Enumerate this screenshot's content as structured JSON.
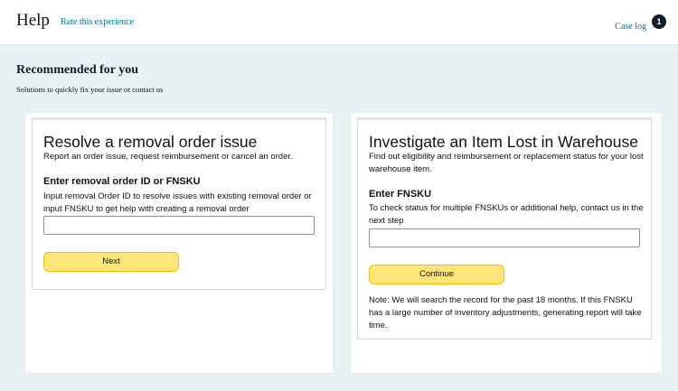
{
  "header": {
    "title": "Help",
    "rate_link": "Rate this experience",
    "case_log": "Case log",
    "case_count": "1"
  },
  "recommended": {
    "title": "Recommended for you",
    "subtitle": "Solutions to quickly fix your issue or contact us"
  },
  "card_removal": {
    "title": "Resolve a removal order issue",
    "description": "Report an order issue, request reimbursement or cancel an order.",
    "field_label": "Enter removal order ID or FNSKU",
    "field_help": "Input removal Order ID to resolve issues with existing removal order or input FNSKU to get help with creating a removal order",
    "input_value": "",
    "button_label": "Next"
  },
  "card_lost": {
    "title": "Investigate an Item Lost in Warehouse",
    "description": "Find out eligibility and reimbursement or replacement status for your lost warehouse item.",
    "field_label": "Enter FNSKU",
    "field_help": "To check status for multiple FNSKUs or additional help, contact us in the next step",
    "input_value": "",
    "button_label": "Continue",
    "note": "Note: We will search the record for the past 18 months. If this FNSKU has a large number of inventory adjustments, generating report will take time."
  }
}
